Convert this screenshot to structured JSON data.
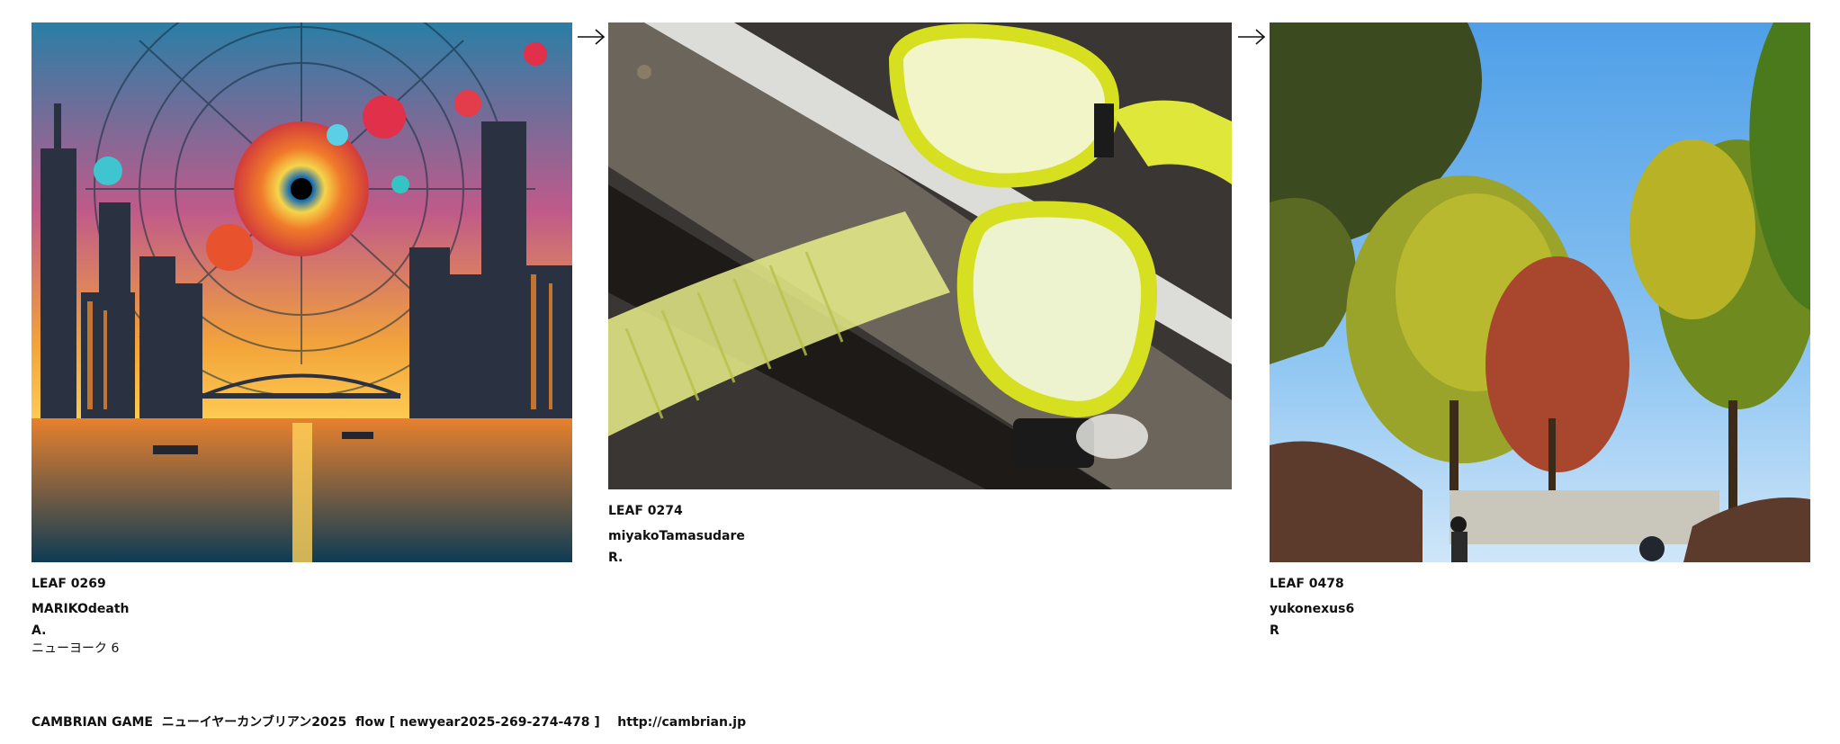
{
  "leaves": [
    {
      "title": "LEAF 0269",
      "user": "MARIKOdeath",
      "note": "A.",
      "caption": "ニューヨーク 6",
      "image": "surreal-city-eye-painting"
    },
    {
      "title": "LEAF 0274",
      "user": "miyakoTamasudare",
      "note": "R.",
      "caption": "",
      "image": "snorkel-mask-photo"
    },
    {
      "title": "LEAF 0478",
      "user": "yukonexus6",
      "note": "R",
      "caption": "",
      "image": "ginkgo-trees-photo"
    }
  ],
  "arrows": [
    "arrow-right-icon",
    "arrow-right-icon"
  ],
  "footer": {
    "text": "CAMBRIAN GAME  ニューイヤーカンブリアン2025  flow [ newyear2025-269-274-478 ]    http://cambrian.jp"
  },
  "colors": {
    "text": "#111111",
    "background": "#ffffff"
  }
}
